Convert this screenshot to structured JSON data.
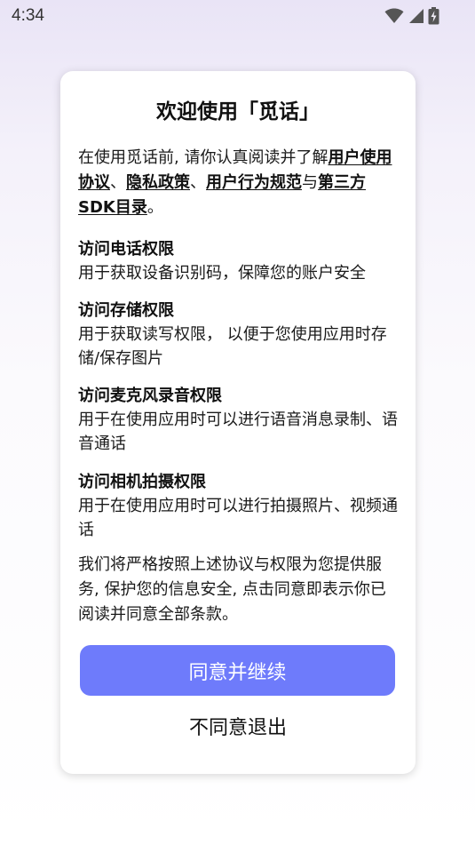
{
  "status_bar": {
    "time": "4:34",
    "icons": [
      "wifi-icon",
      "cellular-signal-icon",
      "battery-charging-icon"
    ]
  },
  "dialog": {
    "title": "欢迎使用「觅话」",
    "intro": {
      "prefix": "在使用觅话前, 请你认真阅读并了解",
      "link_user_agreement": "用户使用协议",
      "sep1": "、",
      "link_privacy_policy": "隐私政策",
      "sep2": "、",
      "link_behavior_rules": "用户行为规范",
      "conj": "与",
      "link_sdk_list": "第三方SDK目录",
      "suffix": "。"
    },
    "permissions": [
      {
        "title": "访问电话权限",
        "desc": "用于获取设备识别码，保障您的账户安全"
      },
      {
        "title": "访问存储权限",
        "desc": "用于获取读写权限， 以便于您使用应用时存储/保存图片"
      },
      {
        "title": "访问麦克风录音权限",
        "desc": "用于在使用应用时可以进行语音消息录制、语音通话"
      },
      {
        "title": "访问相机拍摄权限",
        "desc": "用于在使用应用时可以进行拍摄照片、视频通话"
      }
    ],
    "notice": "我们将严格按照上述协议与权限为您提供服务, 保护您的信息安全, 点击同意即表示你已阅读并同意全部条款。",
    "agree_label": "同意并继续",
    "disagree_label": "不同意退出"
  },
  "colors": {
    "accent": "#6e7bfb",
    "background_top": "#e9e4f6",
    "card": "#ffffff"
  }
}
